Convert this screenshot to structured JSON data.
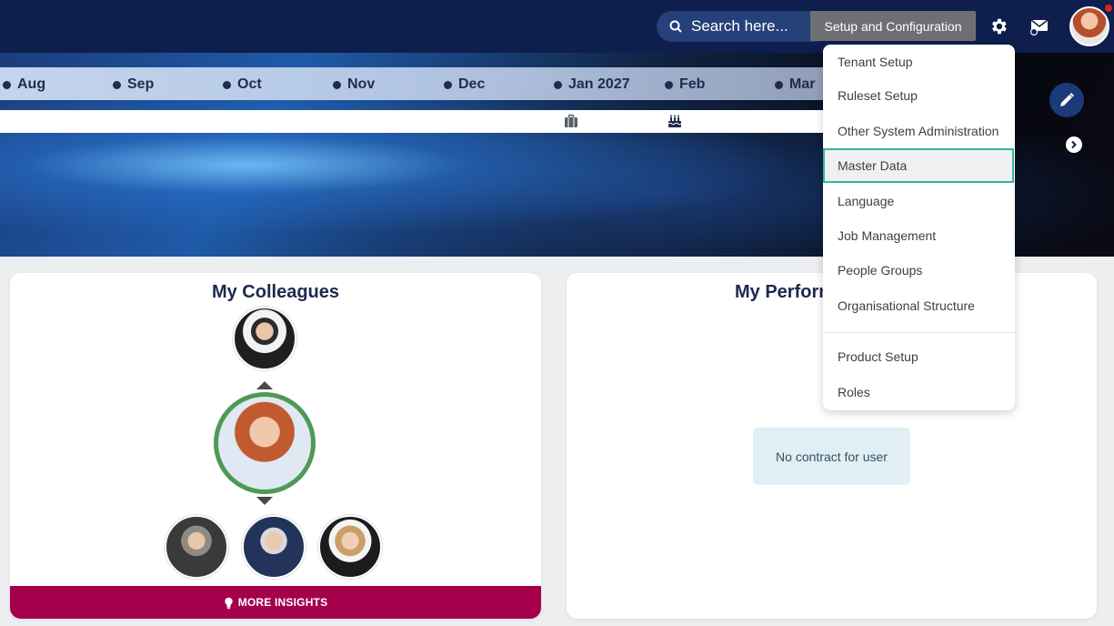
{
  "header": {
    "search_placeholder": "Search here...",
    "tooltip": "Setup and Configuration"
  },
  "timeline": {
    "months": [
      "Aug",
      "Sep",
      "Oct",
      "Nov",
      "Dec",
      "Jan 2027",
      "Feb",
      "Mar"
    ]
  },
  "colleagues": {
    "title": "My Colleagues",
    "insights_label": "MORE INSIGHTS"
  },
  "performance": {
    "title": "My Perform",
    "empty_message": "No contract for user"
  },
  "menu": {
    "items": [
      "Tenant Setup",
      "Ruleset Setup",
      "Other System Administration",
      "Master Data",
      "Language",
      "Job Management",
      "People Groups",
      "Organisational Structure",
      "Product Setup",
      "Roles"
    ],
    "active": "Master Data"
  },
  "colors": {
    "topbar": "#0e1f4d",
    "accent_border": "#34b3a6",
    "insights_bg": "#a6004d",
    "current_user_ring": "#4e9a55"
  },
  "icons": [
    "search-icon",
    "gear-icon",
    "mail-icon",
    "pencil-icon",
    "chevron-right-icon",
    "briefcase-icon",
    "cake-icon",
    "lightbulb-icon"
  ]
}
